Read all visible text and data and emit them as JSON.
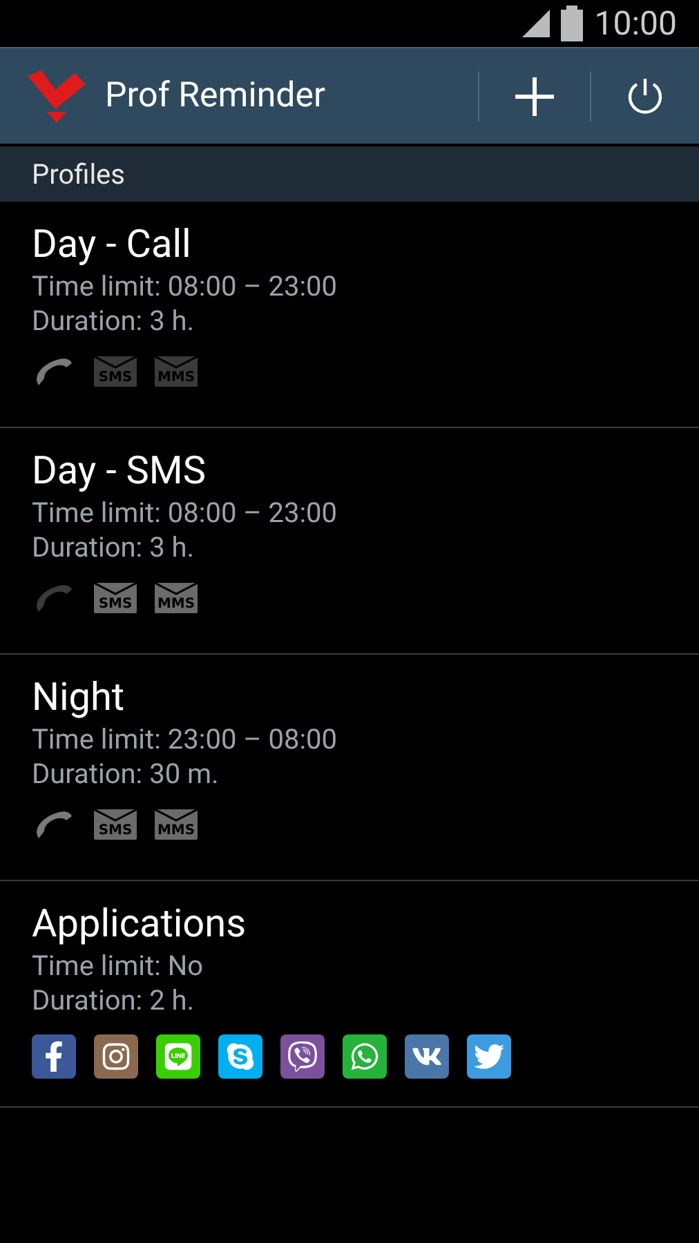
{
  "status_bar": {
    "time": "10:00"
  },
  "action_bar": {
    "title": "Prof Reminder"
  },
  "section": {
    "title": "Profiles"
  },
  "profiles": [
    {
      "name": "Day - Call",
      "time_limit": "Time limit: 08:00 – 23:00",
      "duration": "Duration: 3 h.",
      "icons": [
        {
          "kind": "call",
          "on": true
        },
        {
          "kind": "sms",
          "label": "SMS",
          "on": false
        },
        {
          "kind": "mms",
          "label": "MMS",
          "on": false
        }
      ]
    },
    {
      "name": "Day - SMS",
      "time_limit": "Time limit: 08:00 – 23:00",
      "duration": "Duration: 3 h.",
      "icons": [
        {
          "kind": "call",
          "on": false
        },
        {
          "kind": "sms",
          "label": "SMS",
          "on": true
        },
        {
          "kind": "mms",
          "label": "MMS",
          "on": true
        }
      ]
    },
    {
      "name": "Night",
      "time_limit": "Time limit: 23:00 – 08:00",
      "duration": "Duration: 30 m.",
      "icons": [
        {
          "kind": "call",
          "on": true
        },
        {
          "kind": "sms",
          "label": "SMS",
          "on": true
        },
        {
          "kind": "mms",
          "label": "MMS",
          "on": true
        }
      ]
    },
    {
      "name": "Applications",
      "time_limit": "Time limit: No",
      "duration": "Duration: 2 h.",
      "icons": [
        {
          "kind": "facebook",
          "color": "#3b5998"
        },
        {
          "kind": "instagram",
          "color": "#8a6a4f"
        },
        {
          "kind": "line",
          "color": "#3ace01"
        },
        {
          "kind": "skype",
          "color": "#00aff0"
        },
        {
          "kind": "viber",
          "color": "#7b519d"
        },
        {
          "kind": "whatsapp",
          "color": "#25b33b"
        },
        {
          "kind": "vk",
          "color": "#4a76a8"
        },
        {
          "kind": "twitter",
          "color": "#3d9be0"
        }
      ]
    }
  ]
}
